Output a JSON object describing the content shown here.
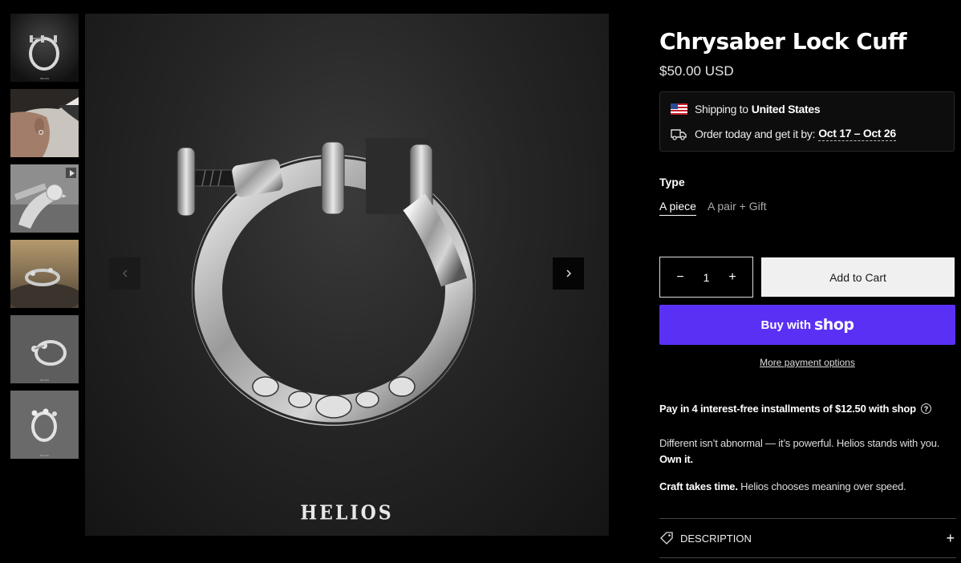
{
  "gallery": {
    "thumbnails": [
      {
        "name": "thumb-cuff-front",
        "caption": "HELIOS"
      },
      {
        "name": "thumb-worn-ear",
        "caption": ""
      },
      {
        "name": "thumb-video-screw",
        "caption": ""
      },
      {
        "name": "thumb-on-rock",
        "caption": ""
      },
      {
        "name": "thumb-cuff-side",
        "caption": "HELIOS"
      },
      {
        "name": "thumb-cuff-angle",
        "caption": "HELIOS"
      }
    ],
    "brand_mark": "HELIOS"
  },
  "product": {
    "title": "Chrysaber Lock Cuff",
    "price": "$50.00 USD"
  },
  "shipping": {
    "label": "Shipping to",
    "country": "United States",
    "delivery_label": "Order today and get it by:",
    "delivery_window": "Oct 17 – Oct 26"
  },
  "variant": {
    "label": "Type",
    "options": [
      "A piece",
      "A pair + Gift"
    ],
    "selected": "A piece"
  },
  "purchase": {
    "quantity": "1",
    "decrement": "−",
    "increment": "+",
    "add_to_cart": "Add to Cart",
    "buy_with": "Buy with",
    "shop_word": "shop",
    "more_payment": "More payment options"
  },
  "installments": {
    "text": "Pay in 4 interest-free installments of $12.50 with shop",
    "help": "?"
  },
  "copy": {
    "p1_text": "Different isn’t abnormal — it’s powerful. Helios stands with you.",
    "p1_bold": "Own it.",
    "p2_bold": "Craft takes time.",
    "p2_text": "Helios chooses meaning over speed."
  },
  "accordion": {
    "description": "DESCRIPTION",
    "toggle": "+"
  },
  "colors": {
    "background": "#000000",
    "shop_purple": "#5a31f4",
    "add_to_cart_bg": "#f0f0f0"
  }
}
